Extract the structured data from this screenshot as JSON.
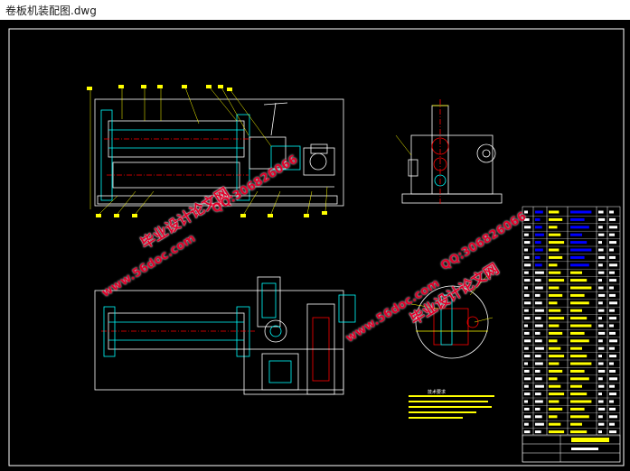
{
  "window": {
    "title": "卷板机装配图.dwg"
  },
  "watermarks": {
    "brand": "毕业设计论文网",
    "url": "www.56doc.com",
    "qq": "QQ:306826066"
  },
  "drawing": {
    "background": "#000000",
    "line_color": "#ffffff",
    "part_color": "#00ffff",
    "label_color": "#ffff00",
    "hatch_color": "#ff0000",
    "table_accent": "#0000ff"
  },
  "notes": {
    "tech_title": "技术要求"
  }
}
